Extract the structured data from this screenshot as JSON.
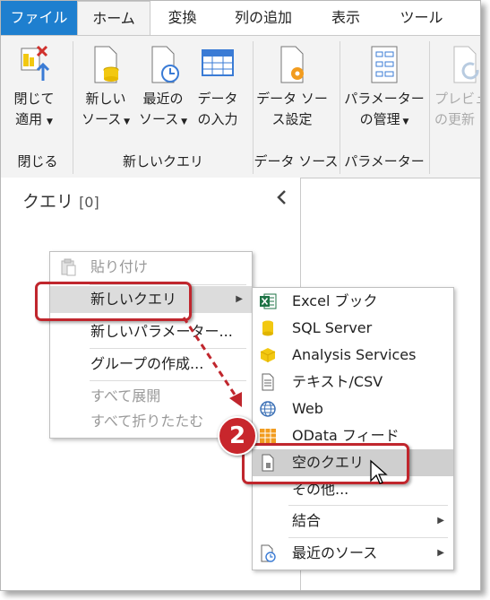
{
  "tabs": [
    "ファイル",
    "ホーム",
    "変換",
    "列の追加",
    "表示",
    "ツール"
  ],
  "ribbon": {
    "close_apply": [
      "閉じて",
      "適用"
    ],
    "new_source": [
      "新しい",
      "ソース"
    ],
    "recent_sources": [
      "最近の",
      "ソース"
    ],
    "enter_data": [
      "データ",
      "の入力"
    ],
    "data_source_settings": [
      "データ ソー",
      "ス設定"
    ],
    "manage_parameters": [
      "パラメーター",
      "の管理"
    ],
    "preview_refresh": [
      "プレビュ",
      "の更新"
    ],
    "groups": [
      "閉じる",
      "新しいクエリ",
      "データ ソース",
      "パラメーター"
    ]
  },
  "query_pane": {
    "title": "クエリ",
    "count": "[0]"
  },
  "context_menu": {
    "items": [
      "貼り付け",
      "新しいクエリ",
      "新しいパラメーター...",
      "グループの作成...",
      "すべて展開",
      "すべて折りたたむ"
    ]
  },
  "submenu": {
    "items": [
      "Excel ブック",
      "SQL Server",
      "Analysis Services",
      "テキスト/CSV",
      "Web",
      "OData フィード",
      "空のクエリ",
      "その他...",
      "結合",
      "最近のソース"
    ]
  },
  "annotation": {
    "step": "2"
  },
  "colors": {
    "file_tab": "#1e7fcf",
    "highlight_red": "#c0262d",
    "excel_green": "#1d7345"
  }
}
